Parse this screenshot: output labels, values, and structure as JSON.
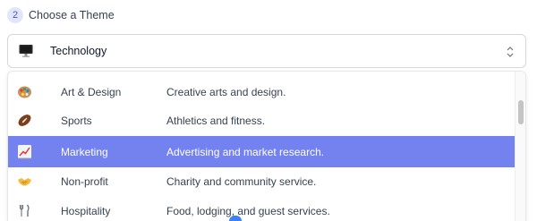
{
  "step": {
    "number": "2",
    "title": "Choose a Theme"
  },
  "select": {
    "value": "Technology",
    "icon": "computer-icon"
  },
  "options": [
    {
      "label": "Art & Design",
      "description": "Creative arts and design.",
      "icon": "palette-icon",
      "active": false
    },
    {
      "label": "Sports",
      "description": "Athletics and fitness.",
      "icon": "football-icon",
      "active": false
    },
    {
      "label": "Marketing",
      "description": "Advertising and market research.",
      "icon": "chart-increasing-icon",
      "active": true
    },
    {
      "label": "Non-profit",
      "description": "Charity and community service.",
      "icon": "handshake-icon",
      "active": false
    },
    {
      "label": "Hospitality",
      "description": "Food, lodging, and guest services.",
      "icon": "fork-knife-icon",
      "active": false
    }
  ],
  "colors": {
    "highlight": "#7482ef",
    "badge_bg": "#e2e6fb",
    "badge_text": "#4b55c9"
  }
}
